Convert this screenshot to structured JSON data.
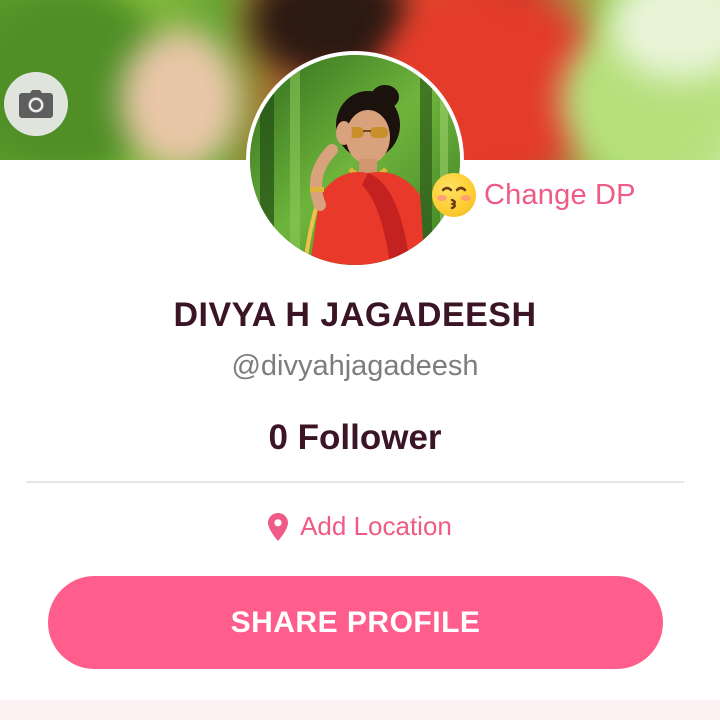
{
  "profile": {
    "name": "DIVYA H JAGADEESH",
    "handle": "@divyahjagadeesh",
    "followers": "0 Follower",
    "change_dp_label": "Change DP",
    "add_location_label": "Add Location",
    "share_button_label": "SHARE PROFILE"
  },
  "icons": {
    "cover_camera": "camera-icon",
    "change_dp": "kissing-face-emoji-icon",
    "location": "location-pin-icon"
  },
  "colors": {
    "accent_pink": "#ff5d8c",
    "link_pink": "#ef5b86",
    "name_text": "#3b1525",
    "handle_text": "#7d7d7d"
  }
}
